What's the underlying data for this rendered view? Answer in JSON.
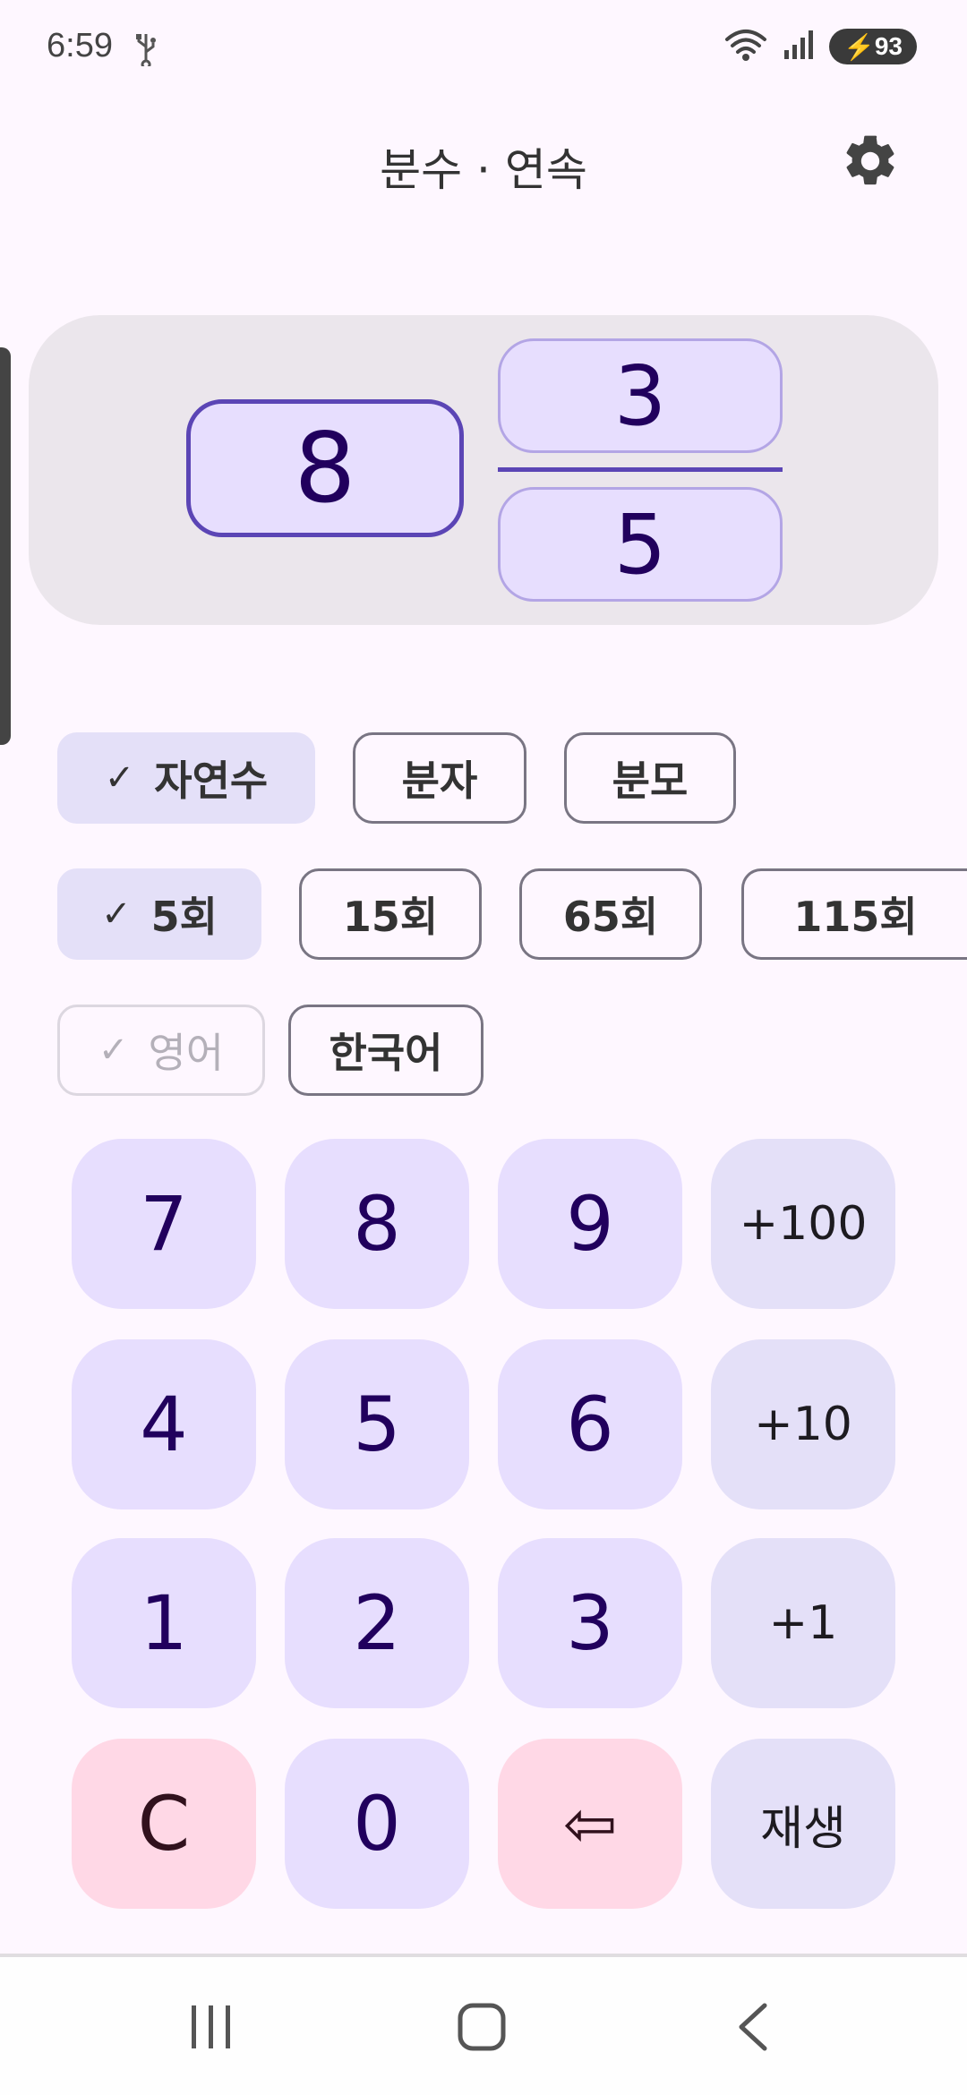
{
  "status": {
    "time": "6:59",
    "battery": "93"
  },
  "header": {
    "title": "분수 · 연속"
  },
  "fraction": {
    "whole": "8",
    "numerator": "3",
    "denominator": "5"
  },
  "chips": {
    "target": [
      {
        "label": "자연수",
        "selected": true
      },
      {
        "label": "분자",
        "selected": false
      },
      {
        "label": "분모",
        "selected": false
      }
    ],
    "repeat": [
      {
        "label": "5회",
        "selected": true
      },
      {
        "label": "15회",
        "selected": false
      },
      {
        "label": "65회",
        "selected": false
      },
      {
        "label": "115회",
        "selected": false
      }
    ],
    "language": [
      {
        "label": "영어",
        "selected": true,
        "disabled": true
      },
      {
        "label": "한국어",
        "selected": false
      }
    ],
    "check": "✓"
  },
  "keypad": {
    "k7": "7",
    "k8": "8",
    "k9": "9",
    "plus100": "+100",
    "k4": "4",
    "k5": "5",
    "k6": "6",
    "plus10": "+10",
    "k1": "1",
    "k2": "2",
    "k3": "3",
    "plus1": "+1",
    "clear": "C",
    "k0": "0",
    "backspace": "⇦",
    "play": "재생"
  },
  "colors": {
    "accent": "#5b45b5",
    "background": "#fef7ff",
    "key": "#e7defe",
    "key_red": "#ffd8e6"
  }
}
